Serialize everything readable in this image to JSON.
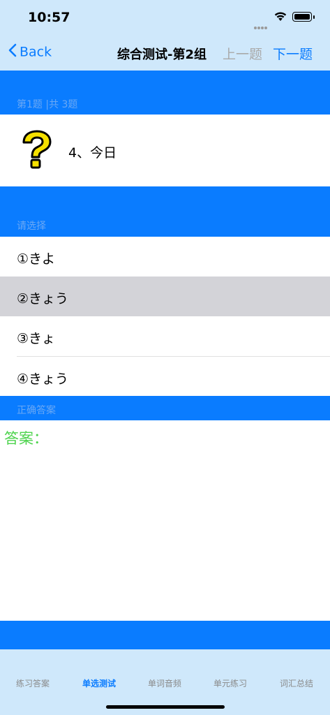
{
  "status": {
    "time": "10:57"
  },
  "nav": {
    "back_label": "Back",
    "title": "综合测试-第2组",
    "prev_label": "上一题",
    "next_label": "下一题"
  },
  "question": {
    "counter": "第1题 |共 3题",
    "text": "4、今日"
  },
  "options_header": "请选择",
  "options": [
    {
      "label": "①きよ",
      "selected": false
    },
    {
      "label": "②きょう",
      "selected": true
    },
    {
      "label": "③きょ",
      "selected": false
    },
    {
      "label": "④きょう",
      "selected": false
    }
  ],
  "correct_answer_header": "正确答案",
  "answer_label": "答案：",
  "tabs": [
    {
      "label": "练习答案",
      "active": false
    },
    {
      "label": "单选测试",
      "active": true
    },
    {
      "label": "单词音频",
      "active": false
    },
    {
      "label": "单元练习",
      "active": false
    },
    {
      "label": "词汇总结",
      "active": false
    }
  ],
  "colors": {
    "accent": "#0a7cff",
    "bar_background": "#cfe8fb",
    "selected_row": "#d3d3d8",
    "answer_green": "#4dd34d"
  }
}
